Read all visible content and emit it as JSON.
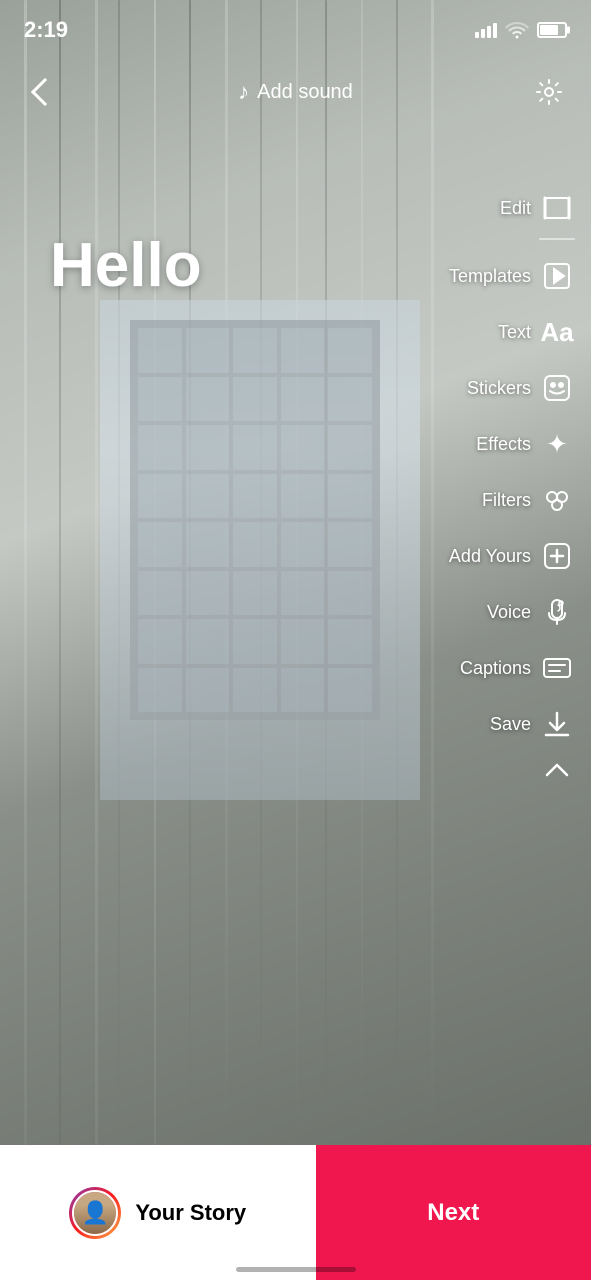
{
  "statusBar": {
    "time": "2:19",
    "battery": "74"
  },
  "topNav": {
    "addSound": "Add sound",
    "backLabel": "back"
  },
  "content": {
    "helloText": "Hello"
  },
  "tools": [
    {
      "id": "edit",
      "label": "Edit",
      "icon": "edit-icon"
    },
    {
      "id": "templates",
      "label": "Templates",
      "icon": "templates-icon"
    },
    {
      "id": "text",
      "label": "Text",
      "icon": "text-icon"
    },
    {
      "id": "stickers",
      "label": "Stickers",
      "icon": "stickers-icon"
    },
    {
      "id": "effects",
      "label": "Effects",
      "icon": "effects-icon"
    },
    {
      "id": "filters",
      "label": "Filters",
      "icon": "filters-icon"
    },
    {
      "id": "add-yours",
      "label": "Add Yours",
      "icon": "add-yours-icon"
    },
    {
      "id": "voice",
      "label": "Voice",
      "icon": "voice-icon"
    },
    {
      "id": "captions",
      "label": "Captions",
      "icon": "captions-icon"
    },
    {
      "id": "save",
      "label": "Save",
      "icon": "save-icon"
    }
  ],
  "bottomBar": {
    "yourStory": "Your Story",
    "next": "Next"
  }
}
